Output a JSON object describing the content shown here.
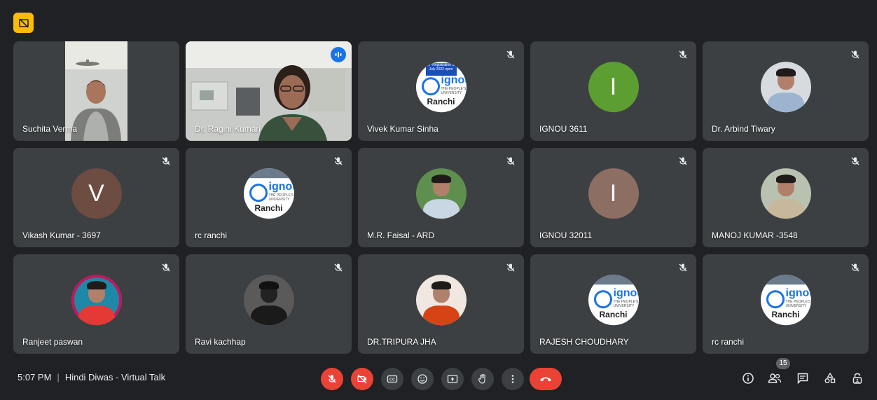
{
  "meeting": {
    "time": "5:07 PM",
    "title": "Hindi Diwas - Virtual Talk",
    "participant_count": "15"
  },
  "logo": {
    "word": "ignou",
    "sub1": "THE PEOPLE'S",
    "sub2": "UNIVERSITY",
    "city": "Ranchi",
    "banner": "Re -Registration for July 2022 open"
  },
  "tiles": [
    {
      "name": "Suchita Verma"
    },
    {
      "name": "Dr. Ragini Kumari"
    },
    {
      "name": "Vivek Kumar Sinha"
    },
    {
      "name": "IGNOU 3611",
      "letter": "I",
      "color": "#5c9e31"
    },
    {
      "name": "Dr. Arbind Tiwary"
    },
    {
      "name": "Vikash Kumar - 3697",
      "letter": "V",
      "color": "#6d4c41"
    },
    {
      "name": "rc ranchi"
    },
    {
      "name": "M.R. Faisal - ARD"
    },
    {
      "name": "IGNOU 32011",
      "letter": "I",
      "color": "#8d6e63"
    },
    {
      "name": "MANOJ KUMAR -3548"
    },
    {
      "name": "Ranjeet paswan"
    },
    {
      "name": "Ravi kachhap"
    },
    {
      "name": "DR.TRIPURA JHA"
    },
    {
      "name": "RAJESH CHOUDHARY"
    },
    {
      "name": "rc ranchi"
    }
  ],
  "colors": {
    "background": "#202124",
    "tile": "#3c4043",
    "active_border": "#8ab4f8",
    "danger": "#ea4335"
  }
}
